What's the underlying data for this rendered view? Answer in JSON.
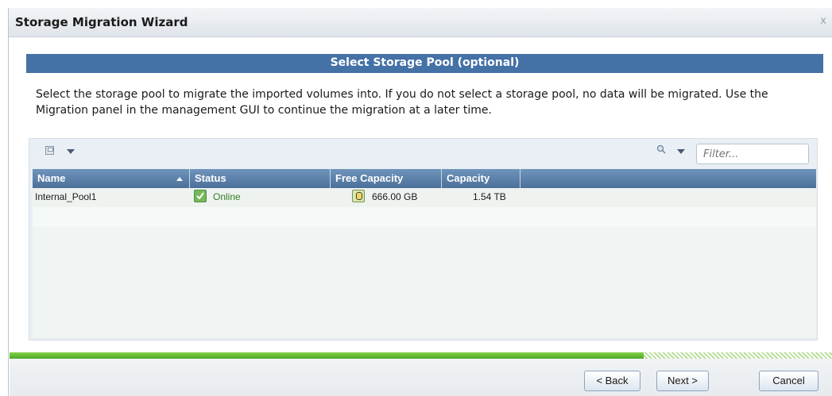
{
  "dialog": {
    "title": "Storage Migration Wizard",
    "close_label": "x",
    "section_title": "Select Storage Pool (optional)",
    "description": "Select the storage pool to migrate the imported volumes into. If you do not select a storage pool, no data will be migrated. Use the Migration panel in the management GUI to continue the migration at a later time."
  },
  "toolbar": {
    "filter_placeholder": "Filter..."
  },
  "table": {
    "columns": [
      "Name",
      "Status",
      "Free Capacity",
      "Capacity"
    ],
    "rows": [
      {
        "name": "Internal_Pool1",
        "status": "Online",
        "free_capacity": "666.00 GB",
        "capacity": "1.54 TB"
      }
    ]
  },
  "progress": {
    "percent": 77
  },
  "footer": {
    "back_label": "< Back",
    "next_label": "Next >",
    "cancel_label": "Cancel"
  }
}
